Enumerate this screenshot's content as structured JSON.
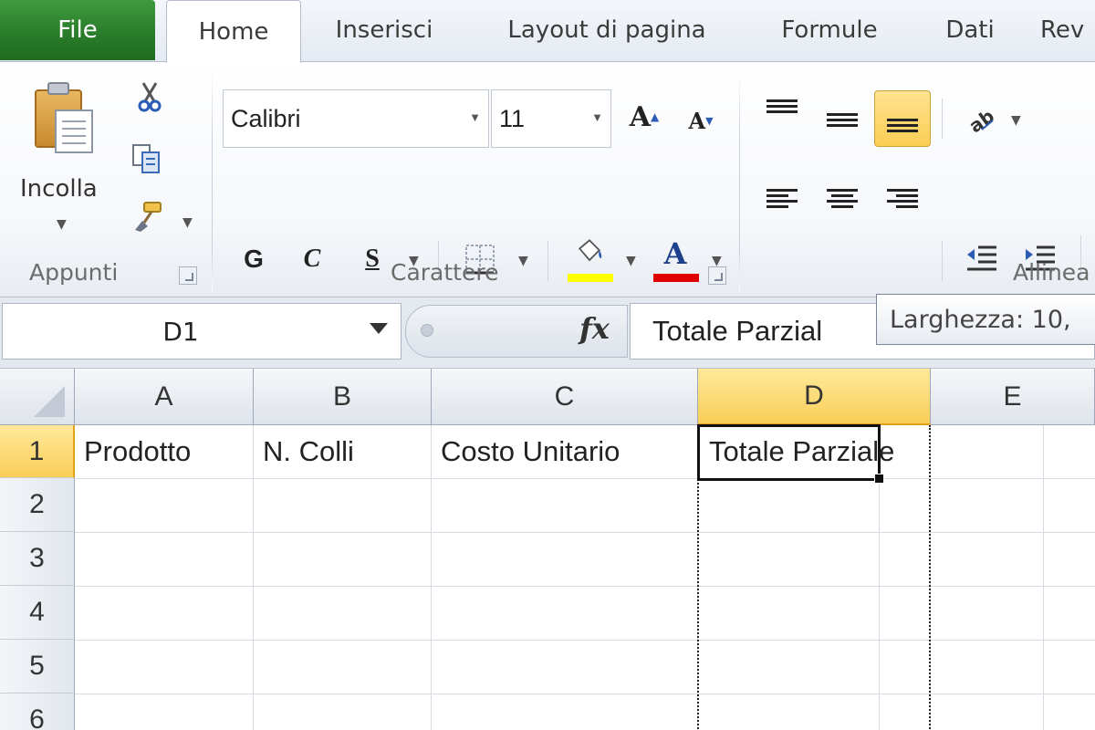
{
  "ribbon_tabs": {
    "file": "File",
    "home": "Home",
    "insert": "Inserisci",
    "page_layout": "Layout di pagina",
    "formulas": "Formule",
    "data": "Dati",
    "review": "Rev"
  },
  "clipboard": {
    "paste_label": "Incolla",
    "group_label": "Appunti"
  },
  "font": {
    "font_name": "Calibri",
    "font_size": "11",
    "grow_label": "A",
    "shrink_label": "A",
    "bold": "G",
    "italic": "C",
    "underline": "S",
    "font_color_label": "A",
    "fill_color": "#ffff00",
    "font_color": "#e00000",
    "group_label": "Carattere"
  },
  "alignment": {
    "group_label": "Allinea",
    "active_vertical": "bottom"
  },
  "formula_bar": {
    "name_box": "D1",
    "fx": "fx",
    "content": "Totale Parzial"
  },
  "tooltip": "Larghezza: 10,",
  "grid": {
    "columns": [
      "A",
      "B",
      "C",
      "D",
      "E"
    ],
    "rows": [
      "1",
      "2",
      "3",
      "4",
      "5",
      "6"
    ],
    "selected_column": "D",
    "selected_row": "1",
    "row1": [
      "Prodotto",
      "N. Colli",
      "Costo Unitario",
      "Totale Parziale",
      ""
    ]
  },
  "colors": {
    "file_tab": "#2a7d2a",
    "selection_header": "#f9cd57",
    "active_button": "#fbcd53"
  }
}
